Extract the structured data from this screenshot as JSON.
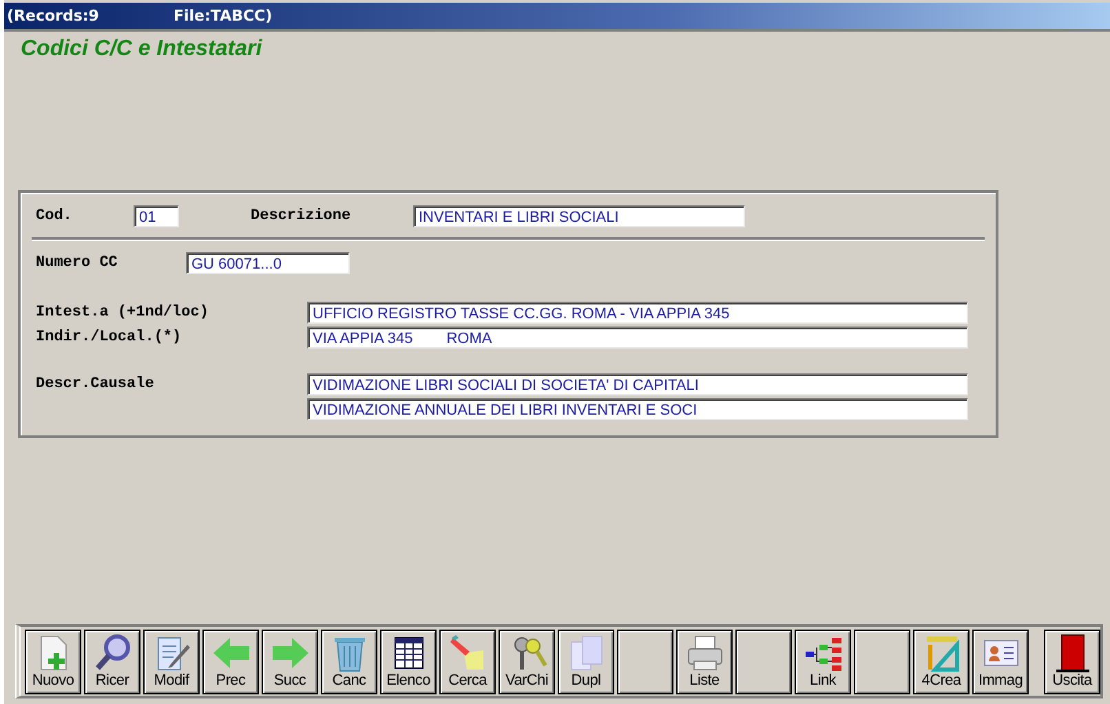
{
  "window": {
    "title_records": "(Records:9",
    "title_file": "File:TABCC)"
  },
  "heading": "Codici C/C e Intestatari",
  "form": {
    "code": {
      "label": "Cod.",
      "value": "01"
    },
    "description": {
      "label": "Descrizione",
      "value": "INVENTARI E LIBRI SOCIALI"
    },
    "account": {
      "label": "Numero CC",
      "value": "GU 60071...0"
    },
    "holder": {
      "label": "Intest.a (+1nd/loc)",
      "value": "UFFICIO REGISTRO TASSE CC.GG. ROMA - VIA APPIA 345"
    },
    "address": {
      "label": "Indir./Local.(*)",
      "value": "VIA APPIA 345        ROMA"
    },
    "reason": {
      "label": "Descr.Causale",
      "values": [
        "VIDIMAZIONE LIBRI SOCIALI DI SOCIETA' DI CAPITALI",
        "VIDIMAZIONE ANNUALE DEI LIBRI INVENTARI E SOCI"
      ]
    }
  },
  "toolbar": [
    {
      "kind": "new",
      "label": "Nuovo"
    },
    {
      "kind": "search",
      "label": "Ricer"
    },
    {
      "kind": "edit",
      "label": "Modif"
    },
    {
      "kind": "prev",
      "label": "Prec"
    },
    {
      "kind": "next",
      "label": "Succ"
    },
    {
      "kind": "delete",
      "label": "Canc"
    },
    {
      "kind": "list",
      "label": "Elenco"
    },
    {
      "kind": "find",
      "label": "Cerca"
    },
    {
      "kind": "keys",
      "label": "VarChi"
    },
    {
      "kind": "duplicate",
      "label": "Dupl"
    },
    {
      "kind": "blank"
    },
    {
      "kind": "print",
      "label": "Liste"
    },
    {
      "kind": "blank"
    },
    {
      "kind": "link",
      "label": "Link"
    },
    {
      "kind": "blank"
    },
    {
      "kind": "tools",
      "label": "4Crea"
    },
    {
      "kind": "card",
      "label": "Immag"
    },
    {
      "kind": "exit",
      "label": "Uscita"
    }
  ]
}
